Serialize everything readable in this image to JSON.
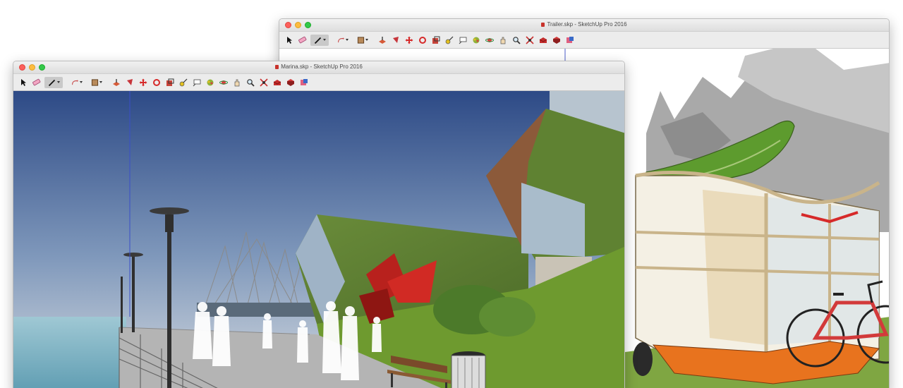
{
  "windows": {
    "back": {
      "title": "Trailer.skp - SketchUp Pro 2016",
      "tools": [
        "select-arrow-icon",
        "eraser-icon",
        "pencil-icon",
        "arc-icon",
        "rectangle-icon",
        "push-pull-icon",
        "offset-icon",
        "move-icon",
        "rotate-icon",
        "scale-icon",
        "tape-measure-icon",
        "text-icon",
        "paint-bucket-icon",
        "orbit-icon",
        "pan-icon",
        "zoom-icon",
        "zoom-extents-icon",
        "warehouse-icon",
        "extension-icon",
        "layout-icon"
      ]
    },
    "front": {
      "title": "Marina.skp - SketchUp Pro 2016",
      "tools": [
        "select-arrow-icon",
        "eraser-icon",
        "pencil-icon",
        "arc-icon",
        "rectangle-icon",
        "push-pull-icon",
        "offset-icon",
        "move-icon",
        "rotate-icon",
        "scale-icon",
        "tape-measure-icon",
        "text-icon",
        "paint-bucket-icon",
        "orbit-icon",
        "pan-icon",
        "zoom-icon",
        "zoom-extents-icon",
        "warehouse-icon",
        "extension-icon",
        "layout-icon"
      ]
    }
  },
  "colors": {
    "sky_top": "#2d4a86",
    "sky_bottom": "#d6dbe0",
    "water": "#7fb5c6",
    "grass": "#6e9a2f",
    "sculpture": "#b8211d",
    "canoe": "#5d9b2e",
    "trailer_floor": "#e8731e"
  }
}
